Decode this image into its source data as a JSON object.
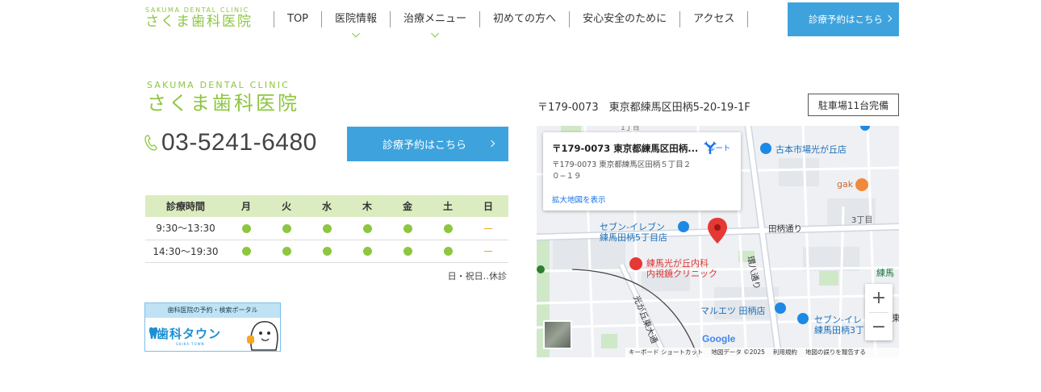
{
  "header": {
    "logo_en": "SAKUMA DENTAL CLINIC",
    "logo_ja": "さくま歯科医院",
    "nav": [
      {
        "label": "TOP"
      },
      {
        "label": "医院情報"
      },
      {
        "label": "治療メニュー"
      },
      {
        "label": "初めての方へ"
      },
      {
        "label": "安心安全のために"
      },
      {
        "label": "アクセス"
      }
    ],
    "reserve_label": "診療予約はこちら"
  },
  "clinic": {
    "logo_en": "SAKUMA DENTAL CLINIC",
    "logo_ja": "さくま歯科医院",
    "phone": "03-5241-6480",
    "reserve_label": "診療予約はこちら"
  },
  "hours": {
    "header": [
      "診療時間",
      "月",
      "火",
      "水",
      "木",
      "金",
      "土",
      "日"
    ],
    "rows": [
      {
        "time": "9:30～13:30",
        "days": [
          "open",
          "open",
          "open",
          "open",
          "open",
          "open",
          "closed"
        ]
      },
      {
        "time": "14:30～19:30",
        "days": [
          "open",
          "open",
          "open",
          "open",
          "open",
          "open",
          "closed"
        ]
      }
    ],
    "closed_note": "日・祝日‥休診"
  },
  "banner": {
    "top": "歯科医院の予約・検索ポータル",
    "brand": "歯科タウン",
    "sub": "SHIKA-TOWN"
  },
  "access": {
    "address": "〒179-0073　東京都練馬区田柄5-20-19-1F",
    "parking": "駐車場11台完備"
  },
  "map": {
    "card_title": "〒179-0073 東京都練馬区田柄...",
    "card_address": "〒179-0073 東京都練馬区田柄５丁目２０−１９",
    "card_link": "拡大地図を表示",
    "route_label": "ルート",
    "labels": {
      "market": "古本市場光が丘店",
      "gak": "gak",
      "chome3": "3丁目",
      "tagara_dori": "田柄通り",
      "seven1_a": "セブン-イレブン",
      "seven1_b": "練馬田柄5丁目店",
      "clinic_a": "練馬光が丘内科",
      "clinic_b": "内視鏡クリニック",
      "kanpachi": "環八通り",
      "hikari": "光が丘東大通",
      "maruetsu": "マルエツ 田柄店",
      "seven2_a": "セブン-イレ",
      "seven2_b": "練馬田柄3丁",
      "nerima": "練馬",
      "east": "東",
      "top_frag": "1丁目"
    },
    "google": "Google",
    "attribution": [
      "キーボード ショートカット",
      "地図データ ©2025",
      "利用規約",
      "地図の誤りを報告する"
    ],
    "colors": {
      "pin": "#e53935",
      "accent": "#8dc63f",
      "brand_blue": "#3ea3dd"
    }
  }
}
